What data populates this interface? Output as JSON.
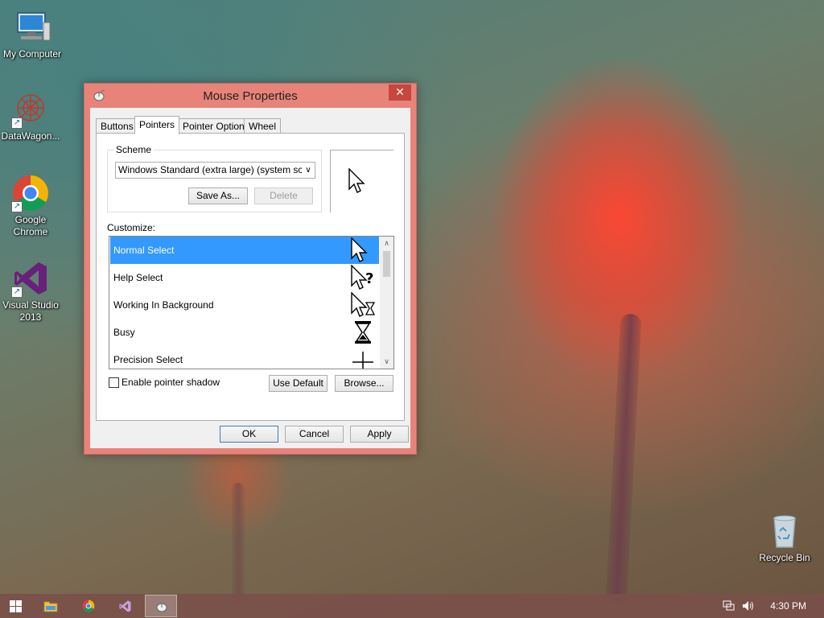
{
  "desktop": {
    "icons": [
      {
        "label": "My Computer"
      },
      {
        "label": "DataWagon..."
      },
      {
        "label": "Google Chrome"
      },
      {
        "label": "Visual Studio 2013"
      },
      {
        "label": "Recycle Bin"
      }
    ]
  },
  "window": {
    "title": "Mouse Properties",
    "close_glyph": "✕",
    "tabs": [
      {
        "label": "Buttons"
      },
      {
        "label": "Pointers",
        "active": true
      },
      {
        "label": "Pointer Options"
      },
      {
        "label": "Wheel"
      }
    ],
    "scheme": {
      "legend": "Scheme",
      "selected": "Windows Standard (extra large) (system scheme)",
      "save_as_label": "Save As...",
      "delete_label": "Delete"
    },
    "customize_label": "Customize:",
    "pointers": [
      {
        "name": "Normal Select",
        "icon": "arrow-cursor-icon",
        "selected": true
      },
      {
        "name": "Help Select",
        "icon": "help-cursor-icon"
      },
      {
        "name": "Working In Background",
        "icon": "working-cursor-icon"
      },
      {
        "name": "Busy",
        "icon": "hourglass-cursor-icon"
      },
      {
        "name": "Precision Select",
        "icon": "crosshair-cursor-icon"
      }
    ],
    "enable_shadow_label": "Enable pointer shadow",
    "use_default_label": "Use Default",
    "browse_label": "Browse...",
    "ok_label": "OK",
    "cancel_label": "Cancel",
    "apply_label": "Apply"
  },
  "taskbar": {
    "clock": "4:30 PM"
  },
  "colors": {
    "selection": "#3399ff",
    "window_frame": "#e8837a",
    "close_button": "#c7463d"
  }
}
